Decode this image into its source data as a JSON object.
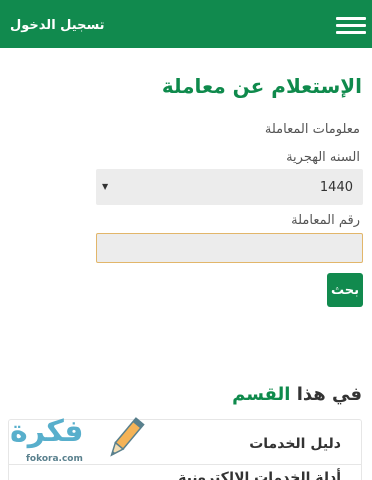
{
  "header": {
    "login_label": "تسجيل الدخول",
    "menu_icon": "hamburger-menu-icon",
    "background_color": "#118a4e"
  },
  "main": {
    "title": "الإستعلام عن معاملة",
    "section_label": "معلومات المعاملة",
    "year_label": "السنه الهجرية",
    "year_value": "1440",
    "transaction_label": "رقم المعاملة",
    "transaction_value": "",
    "search_button": "بحث"
  },
  "section": {
    "heading_part1": "في هذا",
    "heading_part2": "القسم",
    "links": [
      {
        "label": "دليل الخدمات"
      },
      {
        "label": "أدلة الخدمات الإلكترونية"
      }
    ]
  },
  "watermark": {
    "brand": "فكرة",
    "domain": "fokora.com"
  },
  "colors": {
    "accent": "#118a4e",
    "input_border": "#e2b66a",
    "field_bg": "#ececec"
  }
}
